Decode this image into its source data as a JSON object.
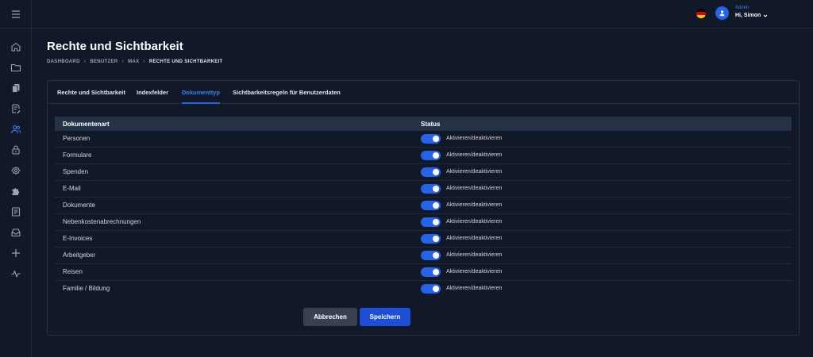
{
  "header": {
    "user_role": "Admin",
    "user_greeting": "Hi, Simon",
    "language": "de",
    "flag_colors": [
      "#000000",
      "#dd0000",
      "#ffce00"
    ]
  },
  "page": {
    "title": "Rechte und Sichtbarkeit",
    "breadcrumb": [
      "DASHBOARD",
      "BENUTZER",
      "MAX",
      "RECHTE UND SICHTBARKEIT"
    ]
  },
  "tabs": [
    {
      "label": "Rechte und Sichtbarkeit",
      "active": false
    },
    {
      "label": "Indexfelder",
      "active": false
    },
    {
      "label": "Dokumenttyp",
      "active": true
    },
    {
      "label": "Sichtbarkeitsregeln für Benutzerdaten",
      "active": false
    }
  ],
  "table": {
    "columns": [
      "Dokumentenart",
      "Status"
    ],
    "rows": [
      {
        "name": "Personen",
        "status_label": "Aktivieren/deaktivieren",
        "enabled": true
      },
      {
        "name": "Formulare",
        "status_label": "Aktivieren/deaktivieren",
        "enabled": true
      },
      {
        "name": "Spenden",
        "status_label": "Aktivieren/deaktivieren",
        "enabled": true
      },
      {
        "name": "E-Mail",
        "status_label": "Aktivieren/deaktivieren",
        "enabled": true
      },
      {
        "name": "Dokumente",
        "status_label": "Aktivieren/deaktivieren",
        "enabled": true
      },
      {
        "name": "Nebenkostenabrechnungen",
        "status_label": "Aktivieren/deaktivieren",
        "enabled": true
      },
      {
        "name": "E-Invoices",
        "status_label": "Aktivieren/deaktivieren",
        "enabled": true
      },
      {
        "name": "Arbeitgeber",
        "status_label": "Aktivieren/deaktivieren",
        "enabled": true
      },
      {
        "name": "Reisen",
        "status_label": "Aktivieren/deaktivieren",
        "enabled": true
      },
      {
        "name": "Familie / Bildung",
        "status_label": "Aktivieren/deaktivieren",
        "enabled": true
      }
    ]
  },
  "actions": {
    "cancel_label": "Abbrechen",
    "save_label": "Speichern"
  },
  "sidebar": {
    "icons": [
      "home-icon",
      "folder-icon",
      "documents-icon",
      "document-edit-icon",
      "users-icon",
      "lock-icon",
      "settings-icon",
      "puzzle-icon",
      "list-icon",
      "inbox-icon",
      "plus-icon",
      "activity-icon"
    ],
    "active_index": 4
  },
  "colors": {
    "accent": "#2563eb",
    "background": "#111827",
    "table_header": "#263247"
  }
}
